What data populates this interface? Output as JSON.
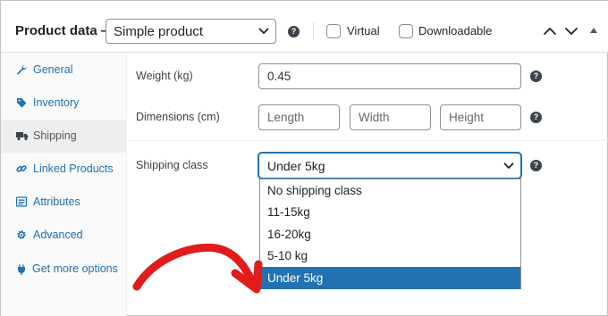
{
  "header": {
    "title": "Product data —",
    "product_type": "Simple product",
    "virtual_label": "Virtual",
    "downloadable_label": "Downloadable",
    "virtual_checked": false,
    "downloadable_checked": false
  },
  "sidebar": {
    "items": [
      {
        "label": "General",
        "icon": "wrench-icon"
      },
      {
        "label": "Inventory",
        "icon": "tag-icon"
      },
      {
        "label": "Shipping",
        "icon": "truck-icon",
        "active": true
      },
      {
        "label": "Linked Products",
        "icon": "link-icon"
      },
      {
        "label": "Attributes",
        "icon": "list-icon"
      },
      {
        "label": "Advanced",
        "icon": "gear-icon"
      },
      {
        "label": "Get more options",
        "icon": "plugin-icon"
      }
    ]
  },
  "shipping": {
    "weight_label": "Weight (kg)",
    "weight_value": "0.45",
    "dimensions_label": "Dimensions (cm)",
    "length_placeholder": "Length",
    "width_placeholder": "Width",
    "height_placeholder": "Height",
    "class_label": "Shipping class",
    "class_value": "Under 5kg",
    "class_options": [
      "No shipping class",
      "11-15kg",
      "16-20kg",
      "5-10 kg",
      "Under 5kg"
    ],
    "selected_option": "Under 5kg"
  },
  "colors": {
    "accent": "#2271b1",
    "annotation_arrow": "#e21b1b"
  }
}
